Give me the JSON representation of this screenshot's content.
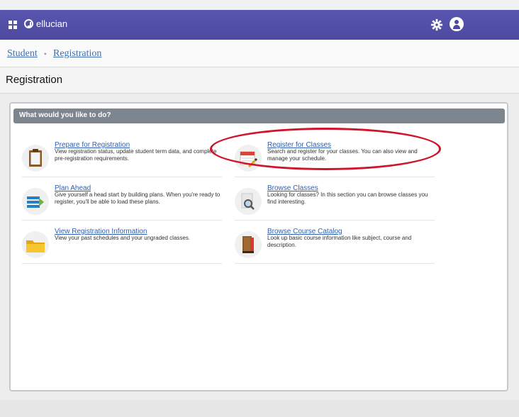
{
  "header": {
    "brand": "ellucian",
    "accent": "#5350a8"
  },
  "breadcrumb": {
    "items": [
      "Student",
      "Registration"
    ],
    "separator": "•"
  },
  "page": {
    "title": "Registration"
  },
  "panel": {
    "heading": "What would you like to do?",
    "items": [
      {
        "icon": "clipboard-icon",
        "label": "Prepare for Registration",
        "description": "View registration status, update student term data, and complete pre-registration requirements."
      },
      {
        "icon": "calendar-pencil-icon",
        "label": "Register for Classes",
        "description": "Search and register for your classes. You can also view and manage your schedule."
      },
      {
        "icon": "plans-icon",
        "label": "Plan Ahead",
        "description": "Give yourself a head start by building plans. When you're ready to register, you'll be able to load these plans."
      },
      {
        "icon": "magnifier-icon",
        "label": "Browse Classes",
        "description": "Looking for classes? In this section you can browse classes you find interesting."
      },
      {
        "icon": "folder-icon",
        "label": "View Registration Information",
        "description": "View your past schedules and your ungraded classes."
      },
      {
        "icon": "book-icon",
        "label": "Browse Course Catalog",
        "description": "Look up basic course information like subject, course and description."
      }
    ]
  },
  "annotation": {
    "highlight_color": "#d0142a"
  }
}
